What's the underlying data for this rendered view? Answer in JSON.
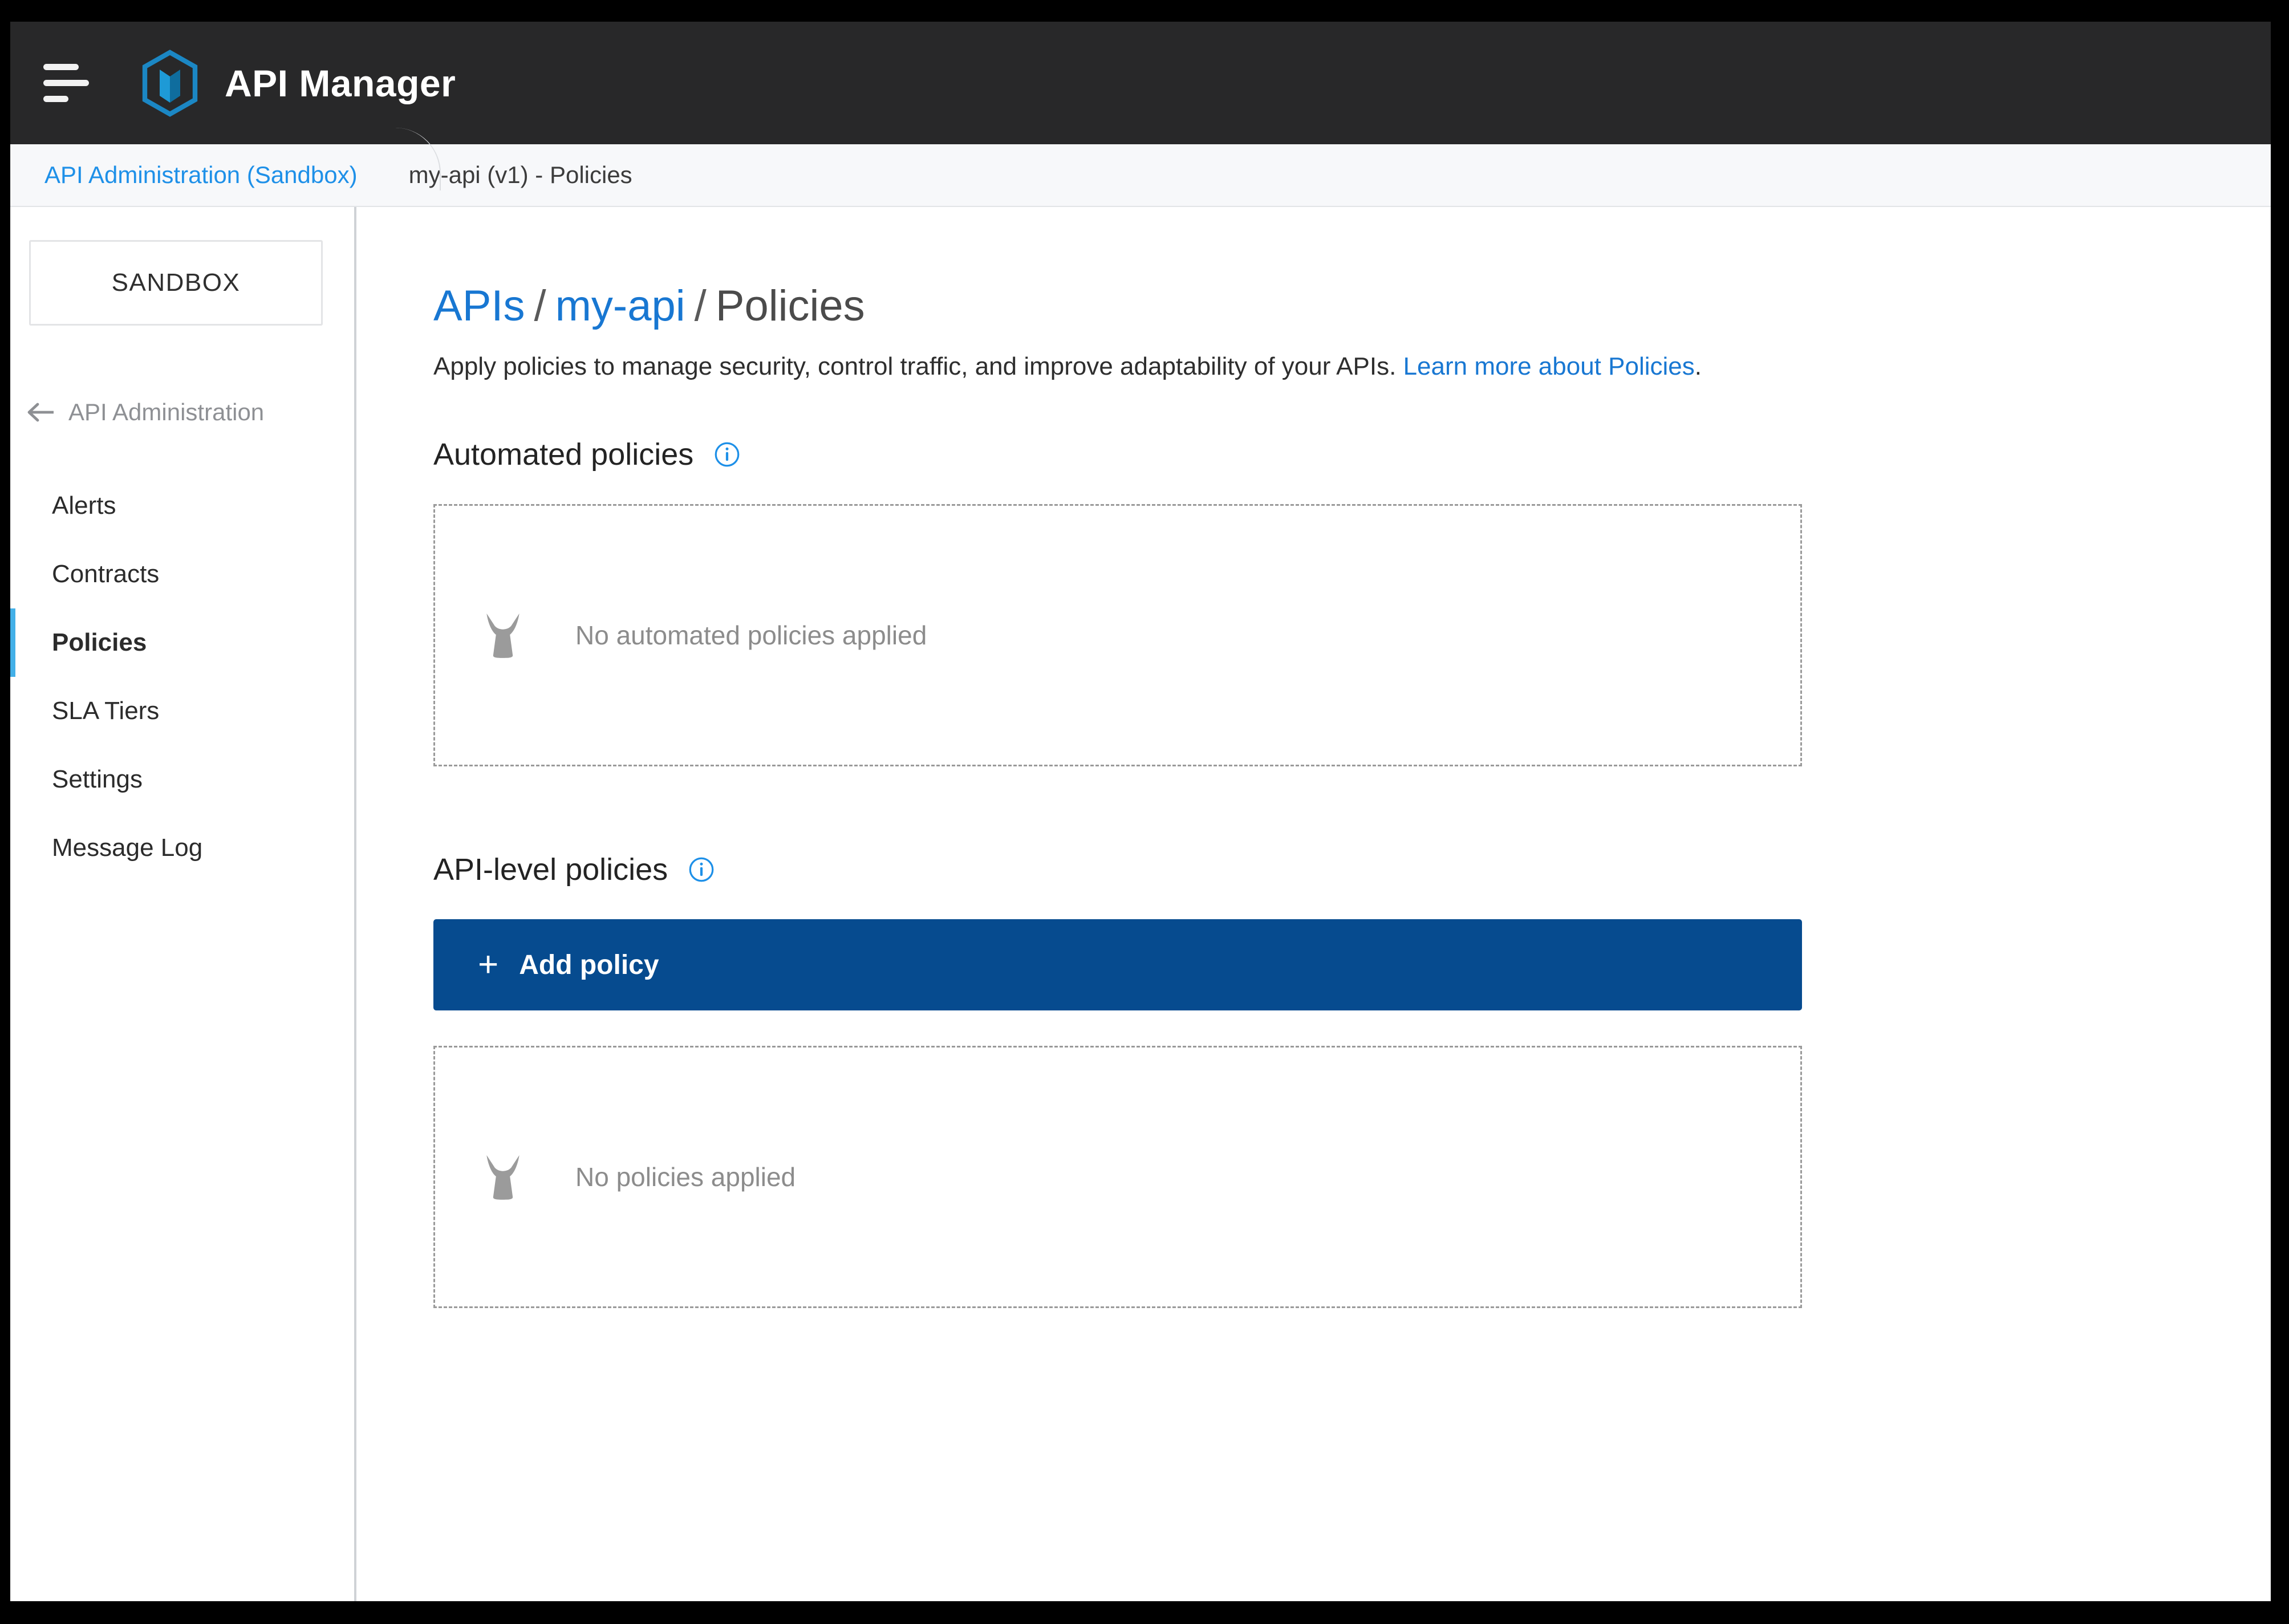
{
  "appbar": {
    "menu_icon": "hamburger-icon",
    "logo_icon": "axway-hexagon-logo",
    "title": "API Manager",
    "background": "#282829",
    "logo_color": "#1e9ad6"
  },
  "breadcrumb_bar": {
    "items": [
      {
        "label": "API Administration (Sandbox)",
        "type": "link",
        "color": "#1e90e8"
      },
      {
        "label": "my-api (v1) - Policies",
        "type": "current",
        "color": "#3c3c3c"
      }
    ]
  },
  "sidebar": {
    "environment_label": "SANDBOX",
    "back": {
      "icon": "arrow-left-icon",
      "label": "API Administration"
    },
    "items": [
      {
        "label": "Alerts",
        "active": false
      },
      {
        "label": "Contracts",
        "active": false
      },
      {
        "label": "Policies",
        "active": true
      },
      {
        "label": "SLA Tiers",
        "active": false
      },
      {
        "label": "Settings",
        "active": false
      },
      {
        "label": "Message Log",
        "active": false
      }
    ],
    "active_indicator_color": "#43b0e8"
  },
  "main": {
    "title": {
      "root": "APIs",
      "separator": "/",
      "api": "my-api",
      "current": "Policies"
    },
    "description": {
      "text": "Apply policies to manage security, control traffic, and improve adaptability of your APIs. ",
      "link": "Learn more about Policies",
      "tail": "."
    },
    "sections": [
      {
        "title": "Automated policies",
        "info_icon": "info-circle-icon",
        "empty_icon": "policy-icon",
        "empty_text": "No automated policies applied",
        "has_add_button": false
      },
      {
        "title": "API-level policies",
        "info_icon": "info-circle-icon",
        "add_button": {
          "icon": "plus-icon",
          "label": "Add policy",
          "color": "#064b8f"
        },
        "empty_icon": "policy-icon",
        "empty_text": "No policies applied",
        "has_add_button": true
      }
    ]
  },
  "colors": {
    "accent_blue": "#1877d2",
    "button_blue": "#064b8f",
    "link_blue": "#1e90e8",
    "appbar_dark": "#282829",
    "muted_gray": "#8c8c8c"
  }
}
